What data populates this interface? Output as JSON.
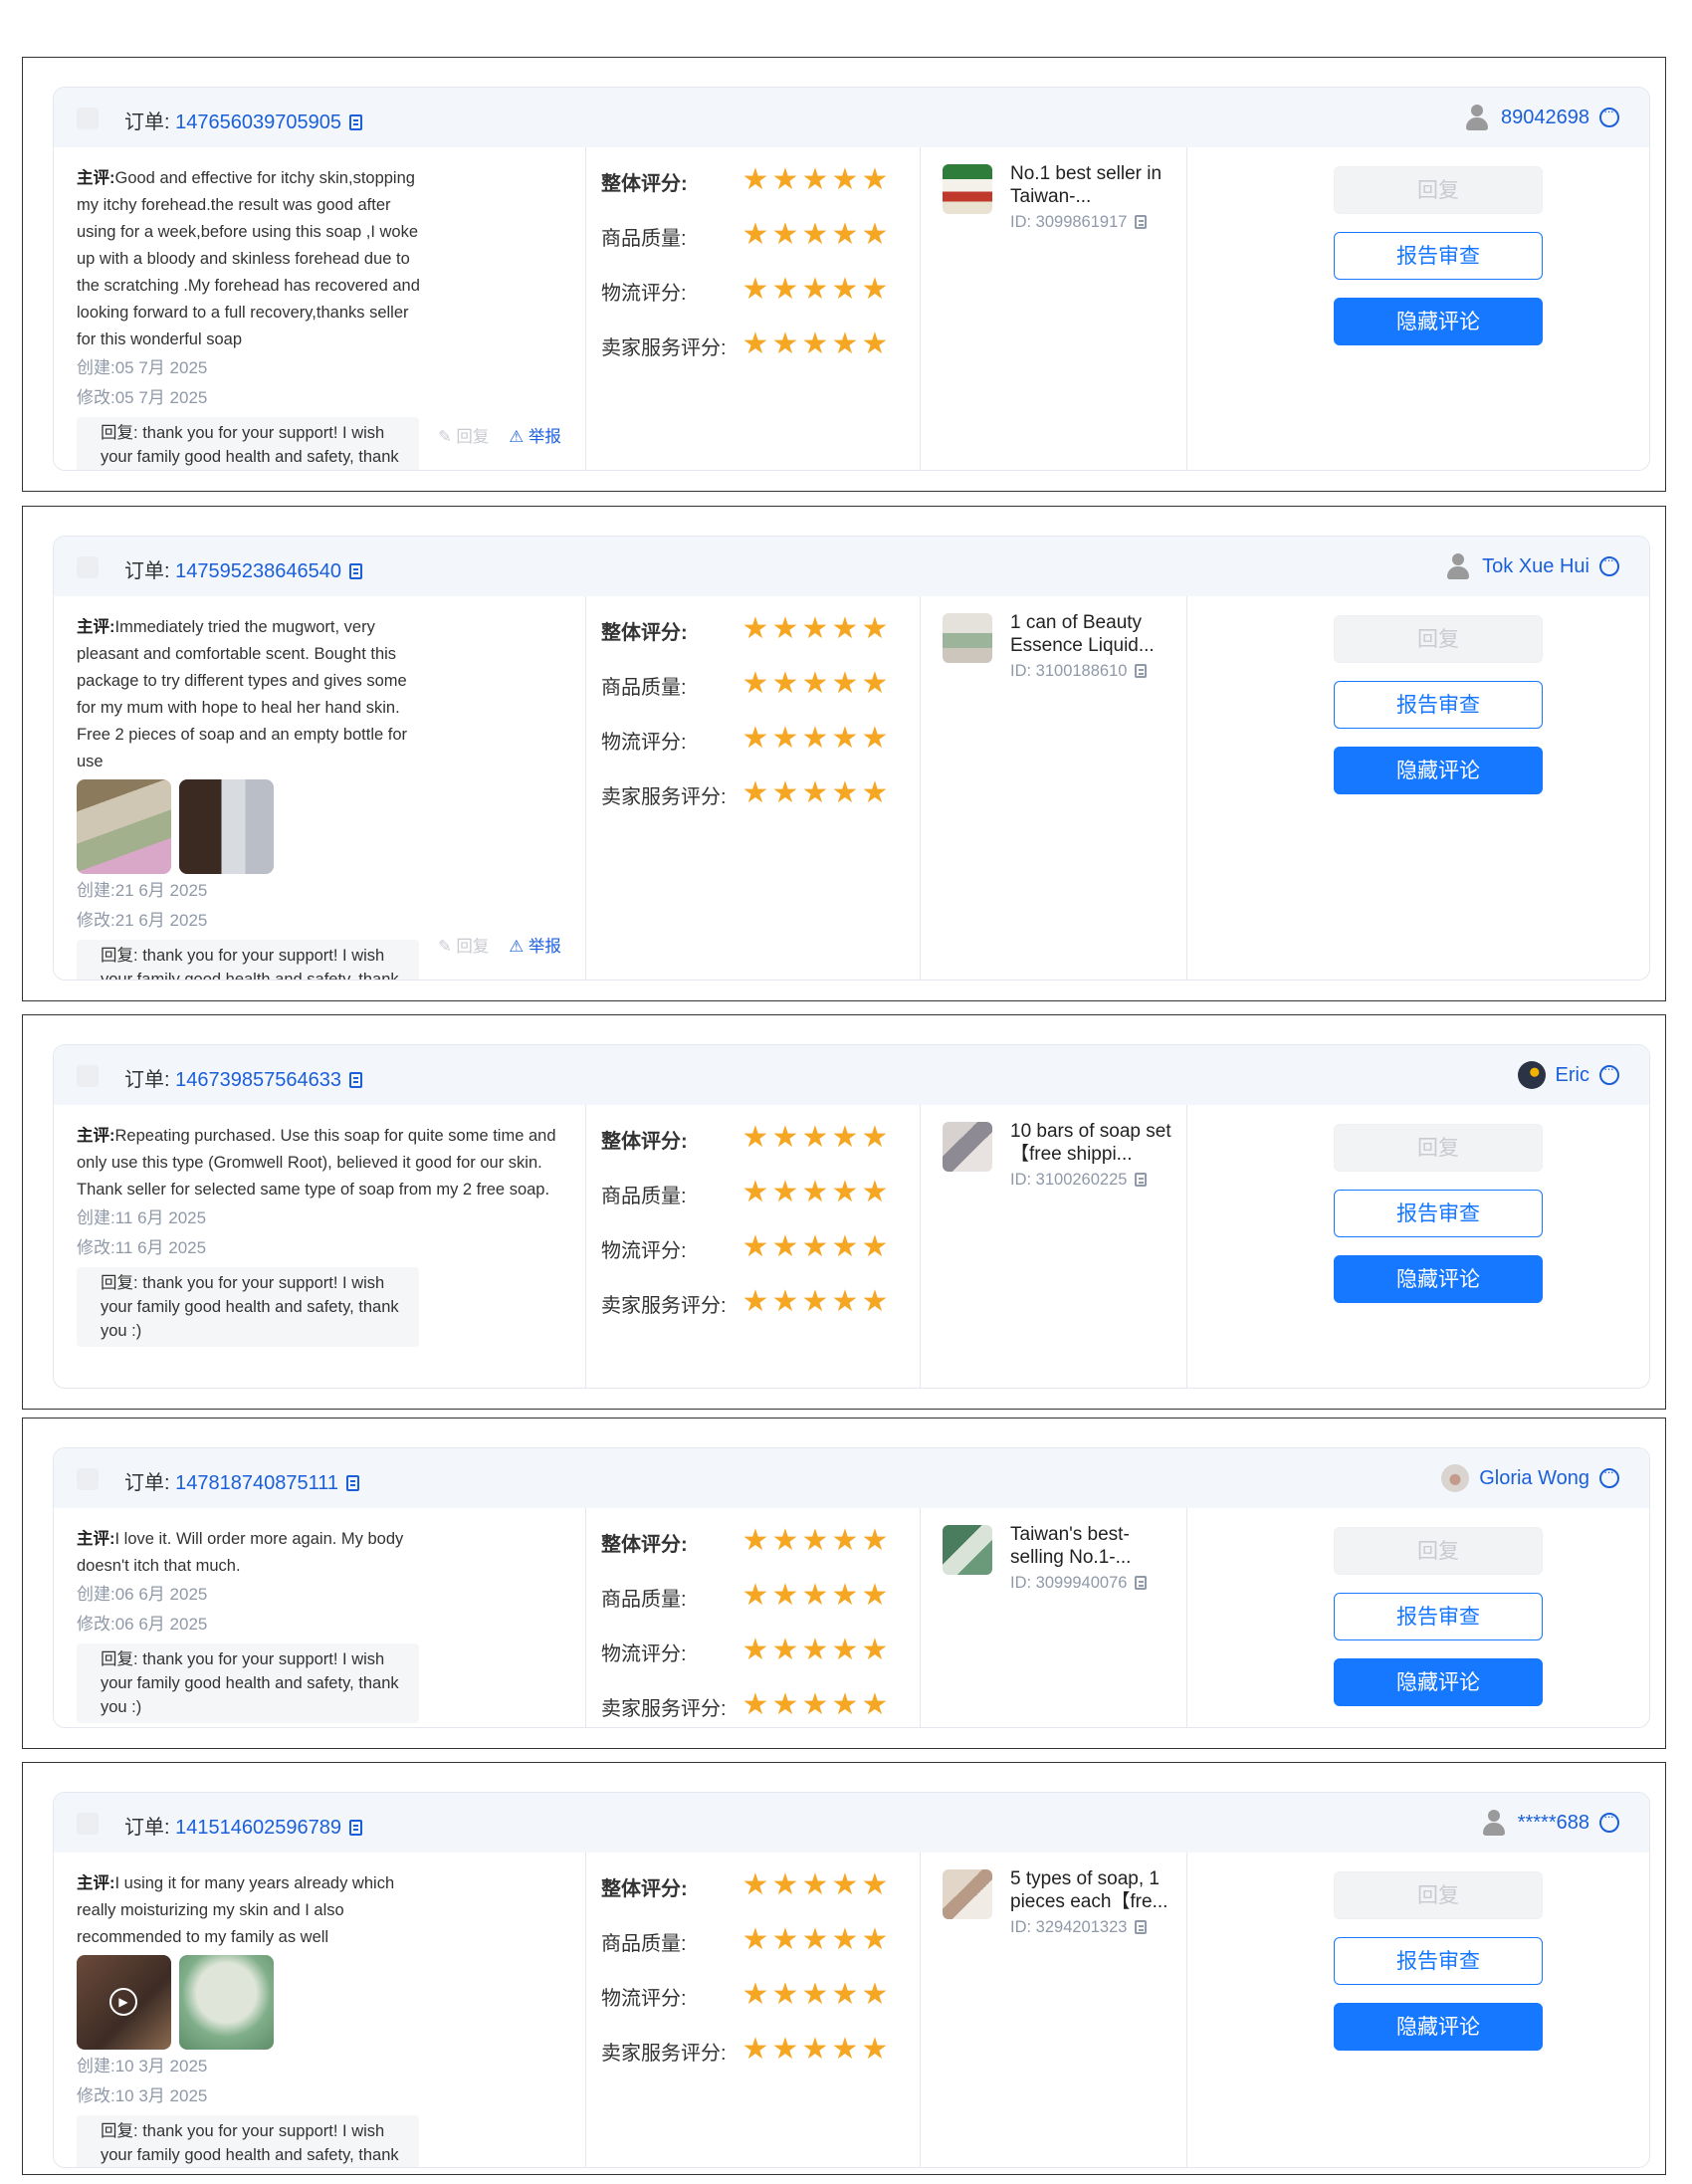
{
  "labels": {
    "order_prefix": "订单:",
    "review_prefix": "主评:",
    "reply_prefix": "回复:",
    "score_overall": "整体评分:",
    "score_quality": "商品质量:",
    "score_logistics": "物流评分:",
    "score_seller": "卖家服务评分:",
    "action_reply": "回复",
    "action_report": "举报",
    "btn_reply": "回复",
    "btn_audit": "报告审查",
    "btn_hide": "隐藏评论"
  },
  "colors": {
    "accent": "#1677ff",
    "link": "#1a5fd9",
    "star": "#f5a623",
    "muted": "#9099a8"
  },
  "reviews": [
    {
      "order_id": "147656039705905",
      "buyer": "89042698",
      "avatar": "person-icon",
      "review_text": "Good and effective for itchy skin,stopping my itchy forehead.the result was good after using for a week,before using this soap ,I woke up with a bloody and skinless forehead due to the scratching .My forehead has recovered and looking forward to a full recovery,thanks seller for this wonderful soap",
      "created": "创建:05 7月 2025",
      "modified": "修改:05 7月 2025",
      "reply_text": "thank you for your support! I wish your family good health and safety, thank you :)",
      "ratings": {
        "overall": 5,
        "quality": 5,
        "logistics": 5,
        "seller": 5
      },
      "product_title": "No.1 best seller in Taiwan-...",
      "product_id": "ID: 3099861917"
    },
    {
      "order_id": "147595238646540",
      "buyer": "Tok Xue Hui",
      "avatar": "person-icon",
      "review_text": "Immediately tried the mugwort, very pleasant and comfortable scent. Bought this package to try different types and gives some for my mum with hope to heal her hand skin. Free 2 pieces of soap and an empty bottle for use",
      "created": "创建:21 6月 2025",
      "modified": "修改:21 6月 2025",
      "reply_text": "thank you for your support! I wish your family good health and safety, thank you :)",
      "ratings": {
        "overall": 5,
        "quality": 5,
        "logistics": 5,
        "seller": 5
      },
      "product_title": "1 can of Beauty Essence Liquid...",
      "product_id": "ID: 3100188610"
    },
    {
      "order_id": "146739857564633",
      "buyer": "Eric",
      "avatar": "user-photo",
      "review_text": "Repeating purchased. Use this soap for quite some time and only use this type (Gromwell Root), believed it good for our skin. Thank seller for selected same type of soap from my 2 free soap.",
      "created": "创建:11 6月 2025",
      "modified": "修改:11 6月 2025",
      "reply_text": "thank you for your support! I wish your family good health and safety, thank you :)",
      "ratings": {
        "overall": 5,
        "quality": 5,
        "logistics": 5,
        "seller": 5
      },
      "product_title": "10 bars of soap set【free shippi...",
      "product_id": "ID: 3100260225"
    },
    {
      "order_id": "147818740875111",
      "buyer": "Gloria Wong",
      "avatar": "user-photo",
      "review_text": "I love it. Will order more again. My body doesn't itch that much.",
      "created": "创建:06 6月 2025",
      "modified": "修改:06 6月 2025",
      "reply_text": "thank you for your support! I wish your family good health and safety, thank you :)",
      "ratings": {
        "overall": 5,
        "quality": 5,
        "logistics": 5,
        "seller": 5
      },
      "product_title": "Taiwan's best-selling No.1-...",
      "product_id": "ID: 3099940076"
    },
    {
      "order_id": "141514602596789",
      "buyer": "*****688",
      "avatar": "person-icon",
      "review_text": "I using it for many years already which really moisturizing my skin and I also recommended to my family as well",
      "created": "创建:10 3月 2025",
      "modified": "修改:10 3月 2025",
      "reply_text": "thank you for your support! I wish your family good health and safety, thank you :)",
      "ratings": {
        "overall": 5,
        "quality": 5,
        "logistics": 5,
        "seller": 5
      },
      "product_title": "5 types of soap, 1 pieces each【fre...",
      "product_id": "ID: 3294201323"
    }
  ]
}
